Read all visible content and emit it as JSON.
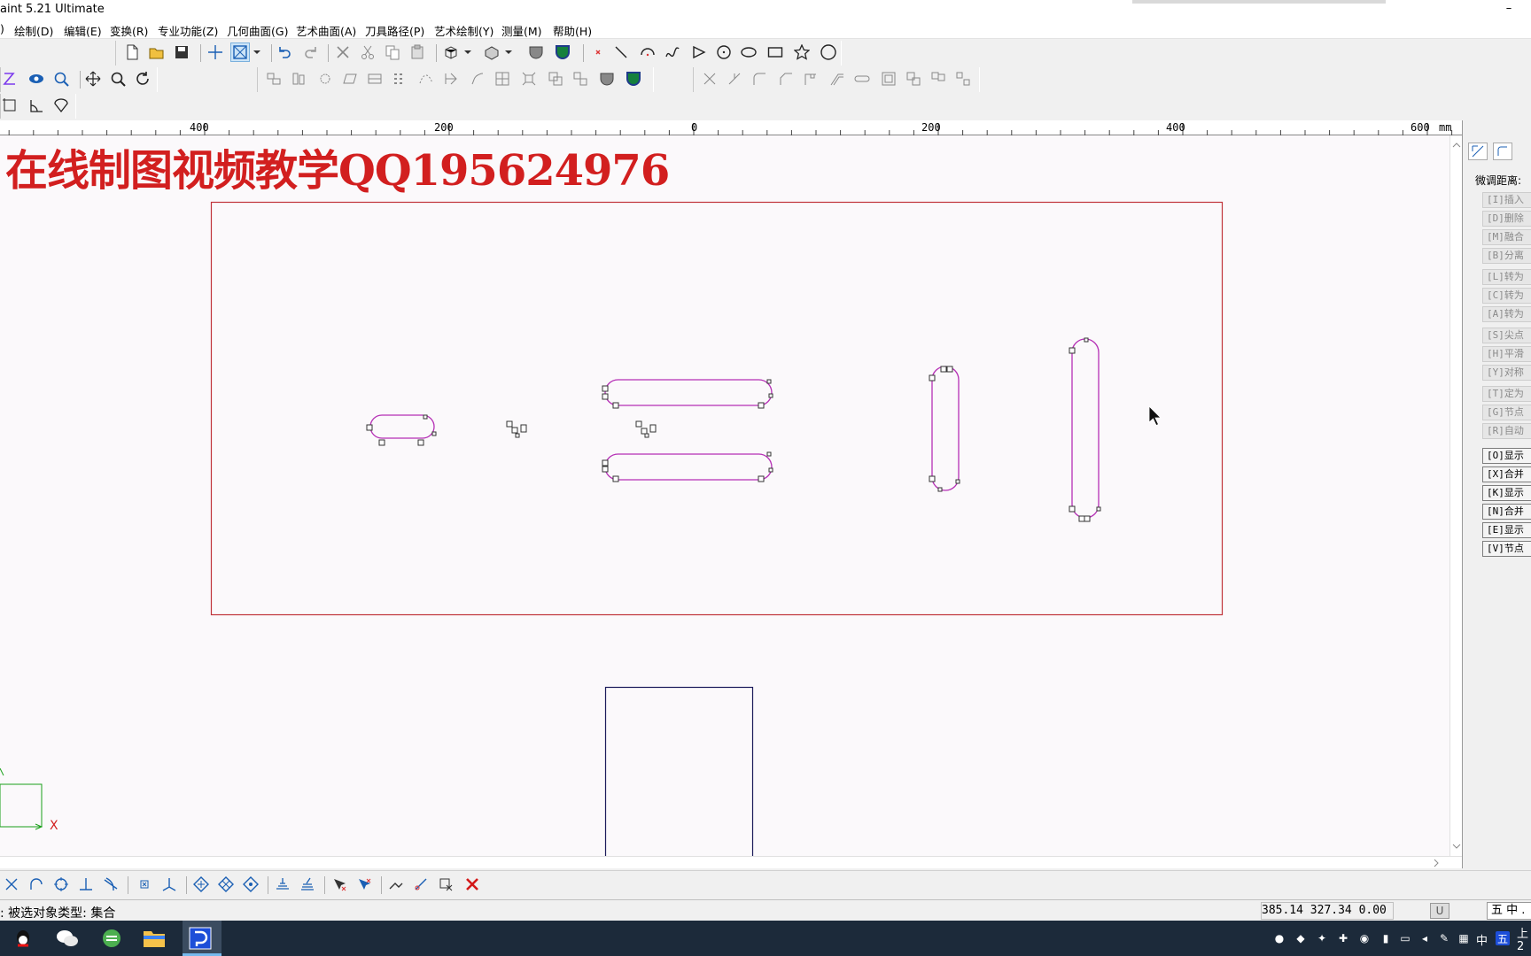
{
  "window": {
    "title": "aint 5.21 Ultimate",
    "minimize": "–",
    "close": "✕"
  },
  "menu": [
    ")",
    "绘制(D)",
    "编辑(E)",
    "变换(R)",
    "专业功能(Z)",
    "几何曲面(G)",
    "艺术曲面(A)",
    "刀具路径(P)",
    "艺术绘制(Y)",
    "测量(M)",
    "帮助(H)"
  ],
  "ruler": {
    "labels": [
      "400",
      "200",
      "0",
      "200",
      "400",
      "600",
      "mm"
    ]
  },
  "canvas": {
    "watermark": "在线制图视频教学QQ195624976",
    "axis_x_label": "X",
    "colors": {
      "workpiece_border": "#c0333a",
      "slot_stroke": "#b52fb5",
      "box_stroke": "#1b1b5a",
      "axis": "#1aa01a"
    }
  },
  "right_panel": {
    "label": "微调距离:",
    "buttons": [
      {
        "text": "[I]插入",
        "enabled": false
      },
      {
        "text": "[D]删除",
        "enabled": false
      },
      {
        "text": "[M]融合",
        "enabled": false
      },
      {
        "text": "[B]分离",
        "enabled": false
      },
      {
        "text": "[L]转为",
        "enabled": false
      },
      {
        "text": "[C]转为",
        "enabled": false
      },
      {
        "text": "[A]转为",
        "enabled": false
      },
      {
        "text": "[S]尖点",
        "enabled": false
      },
      {
        "text": "[H]平滑",
        "enabled": false
      },
      {
        "text": "[Y]对称",
        "enabled": false
      },
      {
        "text": "[T]定为",
        "enabled": false
      },
      {
        "text": "[G]节点",
        "enabled": false
      },
      {
        "text": "[R]自动",
        "enabled": false
      },
      {
        "text": "[O]显示",
        "enabled": true
      },
      {
        "text": "[X]合并",
        "enabled": true
      },
      {
        "text": "[K]显示",
        "enabled": true
      },
      {
        "text": "[N]合并",
        "enabled": true
      },
      {
        "text": "[E]显示",
        "enabled": true
      },
      {
        "text": "[V]节点",
        "enabled": true
      }
    ]
  },
  "status": {
    "message": ": 被选对象类型: 集合",
    "coords": "385.14 327.34 0.00",
    "unit_box": "U",
    "ime": "五 中 ."
  },
  "taskbar": {
    "apps": [
      "qq-icon",
      "wechat-icon",
      "browser-icon",
      "file-explorer-icon",
      "jdpaint-icon"
    ],
    "tray_ime": "中",
    "tray_time": "上",
    "tray_date": "2"
  }
}
